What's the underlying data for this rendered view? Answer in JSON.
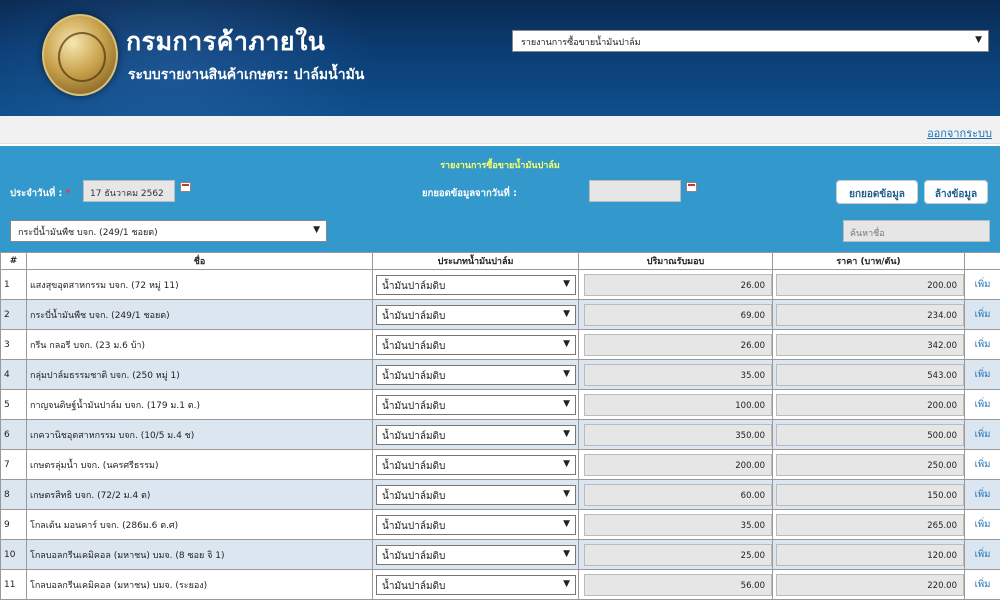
{
  "header": {
    "org_name": "กรมการค้าภายใน",
    "system_name": "ระบบรายงานสินค้าเกษตร: ปาล์มน้ำมัน",
    "report_select_value": "รายงานการซื้อขายน้ำมันปาล์ม"
  },
  "nav": {
    "logout_label": "ออกจากระบบ"
  },
  "form": {
    "title": "รายงานการซื้อขายน้ำมันปาล์ม",
    "date_label": "ประจำวันที่ :",
    "required_mark": "*",
    "date_value": "17 ธันวาคม 2562",
    "carry_label": "ยกยอดข้อมูลจากวันที่ :",
    "carry_value": "",
    "carry_button": "ยกยอดข้อมูล",
    "clear_button": "ล้างข้อมูล",
    "vendor_select_value": "กระบี่น้ำมันพืช บจก. (249/1 ชอยต)",
    "search_placeholder": "ค้นหาชื่อ"
  },
  "table": {
    "headers": [
      "#",
      "ชื่อ",
      "ประเภทน้ำมันปาล์ม",
      "ปริมาณรับมอบ",
      "ราคา (บาท/ตัน)",
      ""
    ],
    "add_label": "เพิ่ม",
    "rows": [
      {
        "no": "1",
        "name": "แสงสุขอุตสาหกรรม บจก. (72 หมู่ 11)",
        "type": "น้ำมันปาล์มดิบ",
        "qty": "26.00",
        "price": "200.00"
      },
      {
        "no": "2",
        "name": "กระบี่น้ำมันพืช บจก. (249/1 ชอยต)",
        "type": "น้ำมันปาล์มดิบ",
        "qty": "69.00",
        "price": "234.00"
      },
      {
        "no": "3",
        "name": "กรีน กลอรี บจก. (23 ม.6 บ้า)",
        "type": "น้ำมันปาล์มดิบ",
        "qty": "26.00",
        "price": "342.00"
      },
      {
        "no": "4",
        "name": "กลุ่มปาล์มธรรมชาติ บจก. (250 หมู่ 1)",
        "type": "น้ำมันปาล์มดิบ",
        "qty": "35.00",
        "price": "543.00"
      },
      {
        "no": "5",
        "name": "กาญจนดิษฐ์น้ำมันปาล์ม บจก. (179 ม.1 ต.)",
        "type": "น้ำมันปาล์มดิบ",
        "qty": "100.00",
        "price": "200.00"
      },
      {
        "no": "6",
        "name": "เกควานิชอุตสาหกรรม บจก. (10/5 ม.4 ช)",
        "type": "น้ำมันปาล์มดิบ",
        "qty": "350.00",
        "price": "500.00"
      },
      {
        "no": "7",
        "name": "เกษตรลุ่มน้ำ บจก. (นครศรีธรรม)",
        "type": "น้ำมันปาล์มดิบ",
        "qty": "200.00",
        "price": "250.00"
      },
      {
        "no": "8",
        "name": "เกษตรสิทธิ บจก. (72/2 ม.4 ต)",
        "type": "น้ำมันปาล์มดิบ",
        "qty": "60.00",
        "price": "150.00"
      },
      {
        "no": "9",
        "name": "โกลเด้น มอนคาร์ บจก. (286ม.6 ต.ศ)",
        "type": "น้ำมันปาล์มดิบ",
        "qty": "35.00",
        "price": "265.00"
      },
      {
        "no": "10",
        "name": "โกลบอลกรีนเคมิคอล (มหาชน) บมจ. (8 ซอย จิ 1)",
        "type": "น้ำมันปาล์มดิบ",
        "qty": "25.00",
        "price": "120.00"
      },
      {
        "no": "11",
        "name": "โกลบอลกรีนเคมิคอล (มหาชน) บมจ. (ระยอง)",
        "type": "น้ำมันปาล์มดิบ",
        "qty": "56.00",
        "price": "220.00"
      }
    ]
  }
}
